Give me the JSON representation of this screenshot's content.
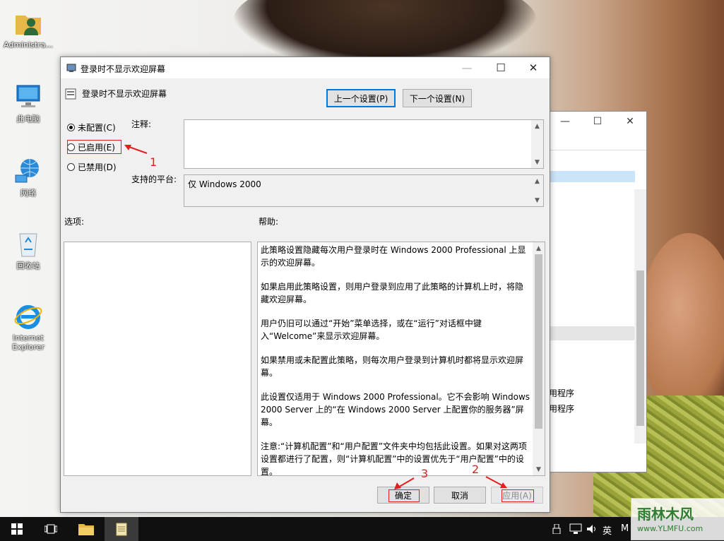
{
  "desktop": {
    "icons": [
      {
        "label": "Administra...",
        "icon": "user-folder-icon"
      },
      {
        "label": "此电脑",
        "icon": "computer-icon"
      },
      {
        "label": "网络",
        "icon": "network-icon"
      },
      {
        "label": "回收站",
        "icon": "recycle-bin-icon"
      },
      {
        "label": "Internet Explorer",
        "icon": "internet-explorer-icon"
      }
    ]
  },
  "background_window": {
    "rows": [
      "用程序",
      "用程序"
    ]
  },
  "dialog": {
    "title": "登录时不显示欢迎屏幕",
    "policy_name": "登录时不显示欢迎屏幕",
    "prev_setting": "上一个设置(P)",
    "next_setting": "下一个设置(N)",
    "options": {
      "not_configured": "未配置(C)",
      "enabled": "已启用(E)",
      "disabled": "已禁用(D)",
      "selected": "not_configured"
    },
    "comment_label": "注释:",
    "comment_value": "",
    "platform_label": "支持的平台:",
    "platform_value": "仅 Windows 2000",
    "options_label": "选项:",
    "help_label": "帮助:",
    "help": [
      "此策略设置隐藏每次用户登录时在 Windows 2000 Professional 上显示的欢迎屏幕。",
      "如果启用此策略设置，则用户登录到应用了此策略的计算机上时，将隐藏欢迎屏幕。",
      "用户仍旧可以通过“开始”菜单选择，或在“运行”对话框中键入“Welcome”来显示欢迎屏幕。",
      "如果禁用或未配置此策略，则每次用户登录到计算机时都将显示欢迎屏幕。",
      "此设置仅适用于 Windows 2000 Professional。它不会影响 Windows 2000 Server 上的“在 Windows 2000 Server 上配置你的服务器”屏幕。",
      "注意:“计算机配置”和“用户配置”文件夹中均包括此设置。如果对这两项设置都进行了配置，则“计算机配置”中的设置优先于“用户配置”中的设置。"
    ],
    "ok": "确定",
    "cancel": "取消",
    "apply": "应用(A)"
  },
  "annotations": {
    "n1": "1",
    "n2": "2",
    "n3": "3",
    "color": "#e02020"
  },
  "taskbar": {
    "items": [
      "start-icon",
      "task-view-icon",
      "file-explorer-icon",
      "notepad-icon"
    ],
    "ime": "英",
    "clock_partial": "M"
  },
  "watermark": {
    "text": "雨林木风",
    "url": "www.YLMFU.com"
  }
}
